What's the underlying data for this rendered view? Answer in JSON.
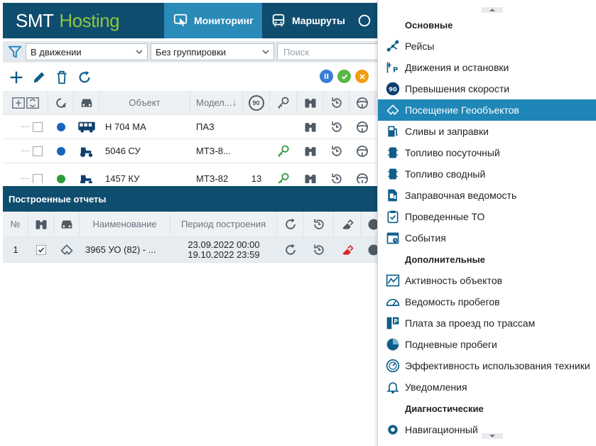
{
  "header": {
    "logo_part1": "SMT",
    "logo_part2": "Hosting",
    "nav": [
      {
        "label": "Мониторинг",
        "active": true
      },
      {
        "label": "Маршруты",
        "active": false
      }
    ]
  },
  "filters": {
    "status_value": "В движении",
    "grouping_value": "Без группировки",
    "search_placeholder": "Поиск"
  },
  "objects_table": {
    "columns": [
      "Объект",
      "Модел...↓"
    ],
    "speed_badge": "90",
    "rows": [
      {
        "name": "Н 704 МА",
        "model": "ПАЗ",
        "speed": "",
        "status_color": "#1565c0"
      },
      {
        "name": "5046 СУ",
        "model": "МТЗ-8...",
        "speed": "",
        "status_color": "#1565c0"
      },
      {
        "name": "1457 КУ",
        "model": "МТЗ-82",
        "speed": "13",
        "status_color": "#2e9a3a"
      }
    ]
  },
  "reports": {
    "title": "Построенные отчеты",
    "columns": {
      "num": "№",
      "name": "Наименование",
      "period": "Период построения"
    },
    "rows": [
      {
        "num": "1",
        "name": "3965 УО (82) - ...",
        "period_from": "23.09.2022 00:00",
        "period_to": "19.10.2022 23:59"
      }
    ]
  },
  "menu": {
    "sections": [
      {
        "title": "Основные",
        "items": [
          {
            "label": "Рейсы",
            "icon": "route-icon"
          },
          {
            "label": "Движения и остановки",
            "icon": "movement-icon"
          },
          {
            "label": "Превышения скорости",
            "icon": "speed-90-icon"
          },
          {
            "label": "Посещение Геообъектов",
            "icon": "geoobject-icon",
            "selected": true
          },
          {
            "label": "Сливы и заправки",
            "icon": "fuel-station-icon"
          },
          {
            "label": "Топливо посуточный",
            "icon": "fuel-barrel-icon"
          },
          {
            "label": "Топливо сводный",
            "icon": "fuel-barrel-icon"
          },
          {
            "label": "Заправочная ведомость",
            "icon": "fuel-sheet-icon"
          },
          {
            "label": "Проведенные ТО",
            "icon": "maintenance-icon"
          },
          {
            "label": "События",
            "icon": "calendar-icon"
          }
        ]
      },
      {
        "title": "Дополнительные",
        "items": [
          {
            "label": "Активность объектов",
            "icon": "activity-chart-icon"
          },
          {
            "label": "Ведомость пробегов",
            "icon": "odometer-icon"
          },
          {
            "label": "Плата за проезд по трассам",
            "icon": "toll-icon"
          },
          {
            "label": "Подневные пробеги",
            "icon": "pie-icon"
          },
          {
            "label": "Эффективность использования техники",
            "icon": "efficiency-gauge-icon"
          },
          {
            "label": "Уведомления",
            "icon": "bell-icon"
          }
        ]
      },
      {
        "title": "Диагностические",
        "items": [
          {
            "label": "Навигационный",
            "icon": "navigation-icon"
          }
        ]
      }
    ]
  },
  "colors": {
    "header_bg": "#0f4d6e",
    "nav_active": "#2a8ab8",
    "menu_selected": "#1f87b8",
    "icon_blue": "#0f5e89",
    "green": "#2e9a3a",
    "logo_green": "#8dc63f"
  }
}
